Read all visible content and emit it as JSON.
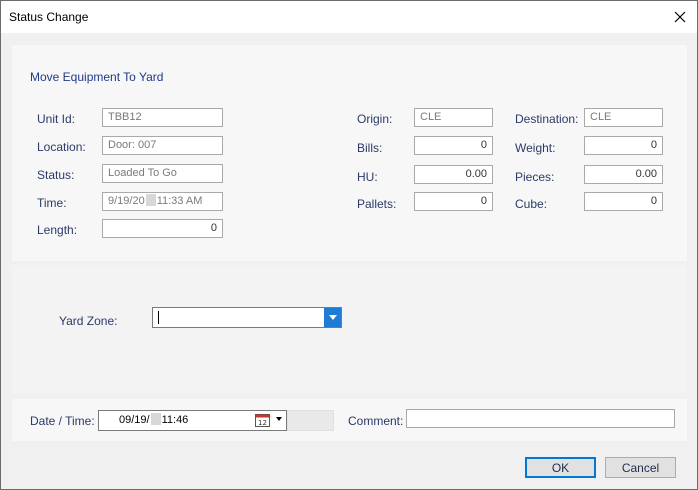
{
  "window": {
    "title": "Status Change"
  },
  "section_title": "Move Equipment To Yard",
  "left_fields": {
    "unit_id": {
      "label": "Unit Id:",
      "value": "TBB12"
    },
    "location": {
      "label": "Location:",
      "value": "Door: 007"
    },
    "status": {
      "label": "Status:",
      "value": "Loaded To Go"
    },
    "time": {
      "label": "Time:",
      "value_prefix": "9/19/20",
      "value_suffix": "11:33 AM"
    },
    "length": {
      "label": "Length:",
      "value": "0"
    }
  },
  "middle_fields": {
    "origin": {
      "label": "Origin:",
      "value": "CLE"
    },
    "bills": {
      "label": "Bills:",
      "value": "0"
    },
    "hu": {
      "label": "HU:",
      "value": "0.00"
    },
    "pallets": {
      "label": "Pallets:",
      "value": "0"
    }
  },
  "right_fields": {
    "destination": {
      "label": "Destination:",
      "value": "CLE"
    },
    "weight": {
      "label": "Weight:",
      "value": "0"
    },
    "pieces": {
      "label": "Pieces:",
      "value": "0.00"
    },
    "cube": {
      "label": "Cube:",
      "value": "0"
    }
  },
  "yard_zone": {
    "label": "Yard Zone:",
    "value": ""
  },
  "date_time": {
    "label": "Date / Time:",
    "value_prefix": "09/19/",
    "value_suffix": "11:46",
    "calendar_day": "12"
  },
  "comment": {
    "label": "Comment:",
    "value": ""
  },
  "buttons": {
    "ok": "OK",
    "cancel": "Cancel"
  },
  "colors": {
    "accent": "#1e7bd6",
    "label_text": "#2b3a67",
    "section_title": "#1f3a8a"
  },
  "icons": {
    "close": "close-icon",
    "calendar": "calendar-icon",
    "dropdown": "chevron-down-icon"
  }
}
